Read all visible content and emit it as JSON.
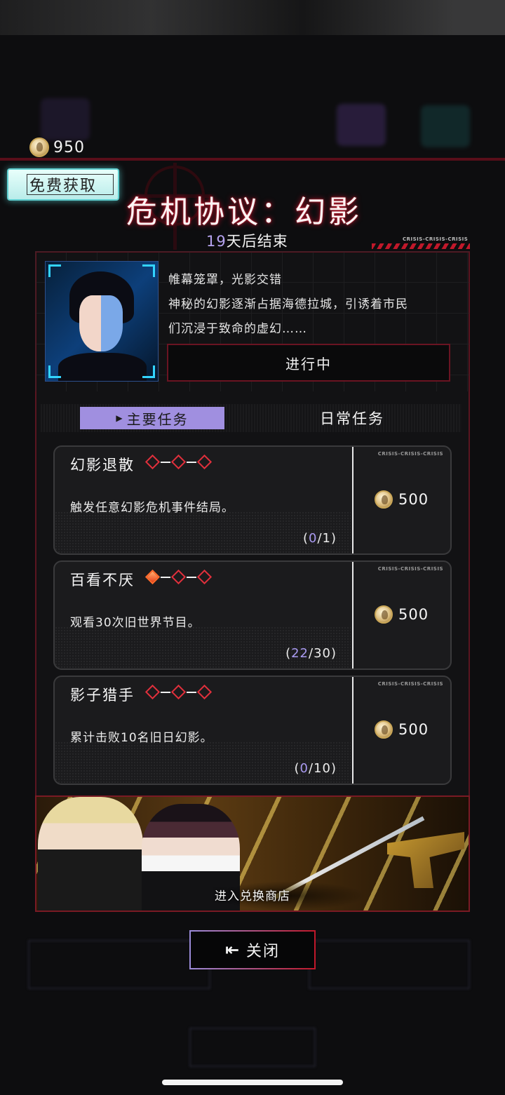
{
  "currency": {
    "amount": "950"
  },
  "free_button": {
    "label": "免费获取"
  },
  "event": {
    "title": "危机协议：幻影",
    "countdown_days": "19",
    "countdown_suffix": "天后结束",
    "description_lines": [
      "帷幕笼罩，光影交错",
      "神秘的幻影逐渐占据海德拉城，引诱着市民",
      "们沉浸于致命的虚幻……"
    ],
    "status": "进行中",
    "crisis_label": "CRISIS-CRISIS-CRISIS"
  },
  "tabs": {
    "main": "主要任务",
    "daily": "日常任务"
  },
  "quests": [
    {
      "title": "幻影退散",
      "stars_filled": 0,
      "stars_total": 3,
      "description": "触发任意幻影危机事件结局。",
      "progress_current": "0",
      "progress_total": "/1)",
      "progress_open": "(",
      "reward": "500",
      "crisis_label": "CRISIS-CRISIS-CRISIS"
    },
    {
      "title": "百看不厌",
      "stars_filled": 1,
      "stars_total": 3,
      "description": "观看30次旧世界节目。",
      "progress_current": "22",
      "progress_total": "/30)",
      "progress_open": "(",
      "reward": "500",
      "crisis_label": "CRISIS-CRISIS-CRISIS"
    },
    {
      "title": "影子猎手",
      "stars_filled": 0,
      "stars_total": 3,
      "description": "累计击败10名旧日幻影。",
      "progress_current": "0",
      "progress_total": "/10)",
      "progress_open": "(",
      "reward": "500",
      "crisis_label": "CRISIS-CRISIS-CRISIS"
    }
  ],
  "shop": {
    "label": "进入兑换商店"
  },
  "close_button": {
    "label": "关闭"
  },
  "colors": {
    "accent_red": "#c0182a",
    "accent_purple": "#a08fe0",
    "coin_gold": "#c9a657"
  }
}
